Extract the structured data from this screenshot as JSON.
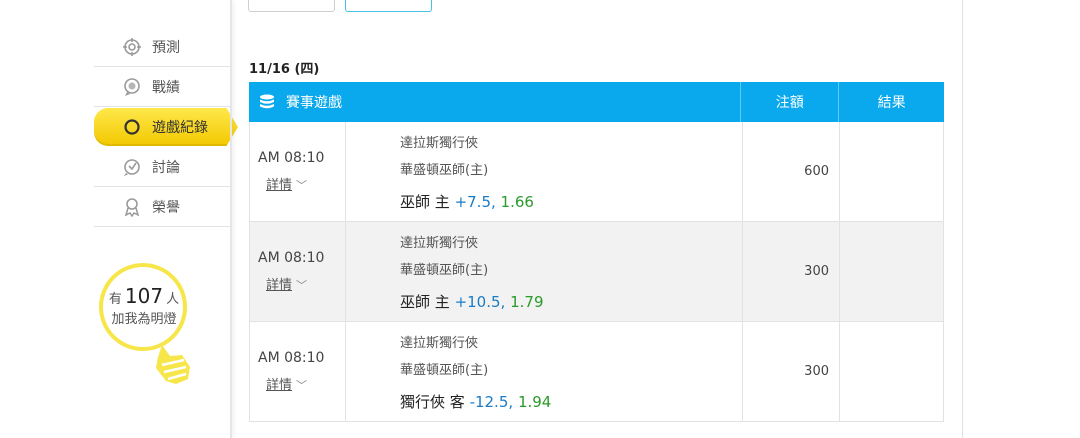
{
  "sidebar": {
    "items": [
      {
        "label": "預測",
        "icon": "target-icon"
      },
      {
        "label": "戰績",
        "icon": "medal-icon"
      },
      {
        "label": "遊戲紀錄",
        "icon": "ring-icon",
        "active": true
      },
      {
        "label": "討論",
        "icon": "chat-icon"
      },
      {
        "label": "榮譽",
        "icon": "award-icon"
      }
    ],
    "bulb": {
      "prefix": "有",
      "count": "107",
      "suffix": "人",
      "line2": "加我為明燈"
    }
  },
  "date_label": "11/16 (四)",
  "table": {
    "headers": {
      "game": "賽事遊戲",
      "amount": "注額",
      "result": "結果"
    },
    "rows": [
      {
        "time": "AM 08:10",
        "detail": "詳情",
        "team_away": "達拉斯獨行俠",
        "team_home": "華盛頓巫師(主)",
        "pick_name": "巫師 主",
        "pick_line": "+7.5,",
        "pick_odds": "1.66",
        "amount": "600",
        "result": ""
      },
      {
        "time": "AM 08:10",
        "detail": "詳情",
        "team_away": "達拉斯獨行俠",
        "team_home": "華盛頓巫師(主)",
        "pick_name": "巫師 主",
        "pick_line": "+10.5,",
        "pick_odds": "1.79",
        "amount": "300",
        "result": ""
      },
      {
        "time": "AM 08:10",
        "detail": "詳情",
        "team_away": "達拉斯獨行俠",
        "team_home": "華盛頓巫師(主)",
        "pick_name": "獨行俠 客",
        "pick_line": "-12.5,",
        "pick_odds": "1.94",
        "amount": "300",
        "result": ""
      }
    ]
  },
  "colors": {
    "header_bg": "#0aa8ec",
    "active_nav": "#f2c800",
    "line_blue": "#1b7bc4",
    "odds_green": "#2a9a2a",
    "bulb_yellow": "#f7e64a"
  }
}
